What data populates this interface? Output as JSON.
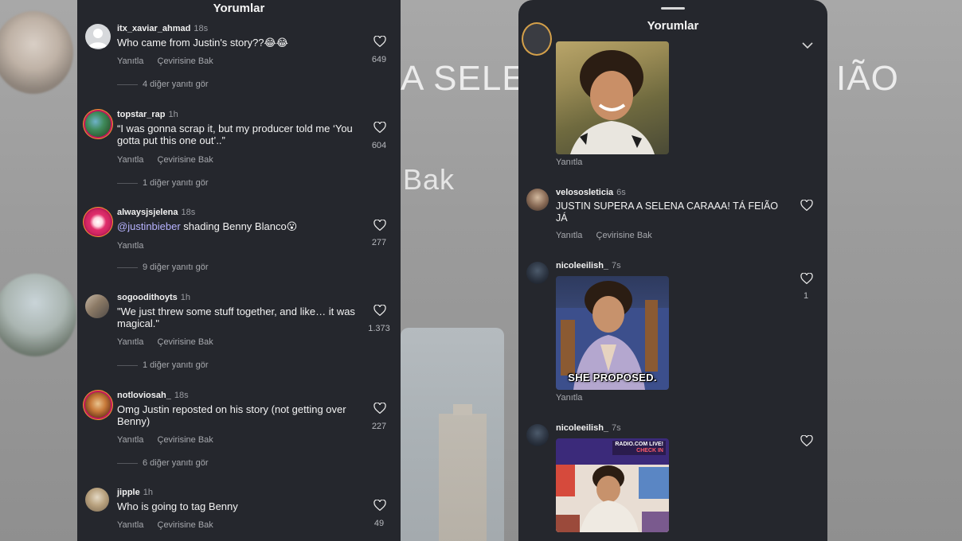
{
  "background": {
    "text_left": "A SELEN",
    "text_right": "IÃO",
    "text_mid": "Bak"
  },
  "left_panel": {
    "title": "Yorumlar",
    "comments": [
      {
        "username": "itx_xaviar_ahmad",
        "time": "18s",
        "text": "Who came from Justin's story??😂😂",
        "reply_label": "Yanıtla",
        "translate_label": "Çevirisine Bak",
        "replies": "4 diğer yanıtı gör",
        "likes": "649",
        "avatar": "default-avatar-icon"
      },
      {
        "username": "topstar_rap",
        "time": "1h",
        "text": "“I was gonna scrap it, but my producer told me ‘You gotta put this one out’..”",
        "reply_label": "Yanıtla",
        "translate_label": "Çevirisine Bak",
        "replies": "1 diğer yanıtı gör",
        "likes": "604",
        "avatar": "story-ring-avatar"
      },
      {
        "username": "alwaysjsjelena",
        "time": "18s",
        "mention": "@justinbieber",
        "text": " shading Benny Blanco😮",
        "reply_label": "Yanıtla",
        "replies": "9 diğer yanıtı gör",
        "likes": "277",
        "avatar": "story-ring-avatar"
      },
      {
        "username": "sogoodithoyts",
        "time": "1h",
        "text": "\"We just threw some stuff together, and like… it was magical.\"",
        "reply_label": "Yanıtla",
        "translate_label": "Çevirisine Bak",
        "replies": "1 diğer yanıtı gör",
        "likes": "1.373",
        "avatar": "photo-avatar"
      },
      {
        "username": "notloviosah_",
        "time": "18s",
        "text": "Omg Justin reposted on his story (not getting over Benny)",
        "reply_label": "Yanıtla",
        "translate_label": "Çevirisine Bak",
        "replies": "6 diğer yanıtı gör",
        "likes": "227",
        "avatar": "story-ring-avatar"
      },
      {
        "username": "jipple",
        "time": "1h",
        "text": "Who is going to tag Benny",
        "reply_label": "Yanıtla",
        "translate_label": "Çevirisine Bak",
        "likes": "49",
        "avatar": "photo-avatar"
      }
    ]
  },
  "right_panel": {
    "title": "Yorumlar",
    "top_reply_label": "Yanıtla",
    "comments": [
      {
        "username": "velososleticia",
        "time": "6s",
        "text": "JUSTIN SUPERA A SELENA CARAAA! TÁ FEIÃO JÁ",
        "reply_label": "Yanıtla",
        "translate_label": "Çevirisine Bak",
        "likes": ""
      },
      {
        "username": "nicoleeilish_",
        "time": "7s",
        "gif_caption": "SHE PROPOSED.",
        "reply_label": "Yanıtla",
        "likes": "1"
      },
      {
        "username": "nicoleeilish_",
        "time": "7s",
        "gif_badge_top": "RADIO.COM LIVE!",
        "gif_badge_bottom": "CHECK IN",
        "likes": ""
      }
    ]
  },
  "colors": {
    "panel_bg": "#25272d",
    "mention": "#b7b3ff",
    "muted_text": "#a7a9ae"
  }
}
